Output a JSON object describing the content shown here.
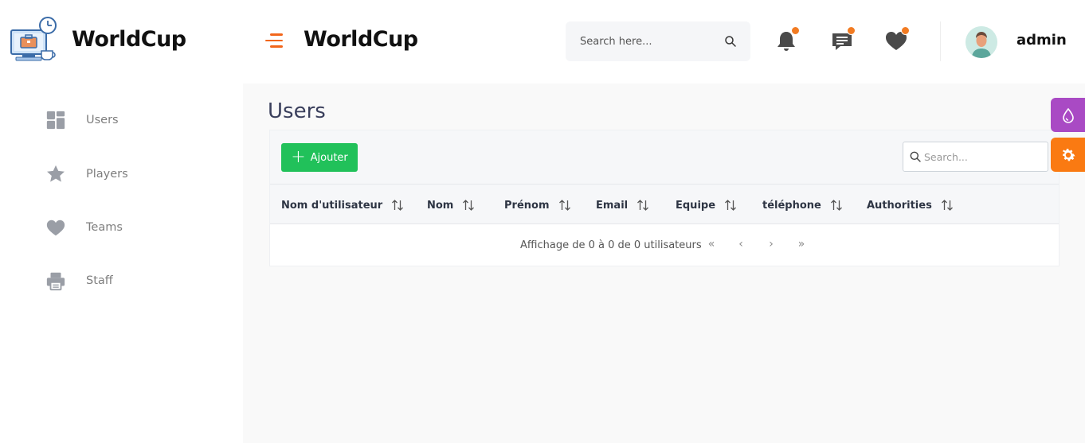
{
  "brand": {
    "name": "WorldCup"
  },
  "header": {
    "title": "WorldCup",
    "search_placeholder": "Search here...",
    "username": "admin",
    "icons": [
      "bell-icon",
      "message-icon",
      "heart-icon"
    ],
    "accent_color": "#f27b22"
  },
  "sidebar": {
    "items": [
      {
        "label": "Users",
        "icon": "dashboard-icon"
      },
      {
        "label": "Players",
        "icon": "star-icon"
      },
      {
        "label": "Teams",
        "icon": "heart-icon"
      },
      {
        "label": "Staff",
        "icon": "printer-icon"
      }
    ]
  },
  "main": {
    "page_title": "Users",
    "add_button_label": "Ajouter",
    "table_search_placeholder": "Search...",
    "columns": [
      "Nom d'utilisateur",
      "Nom",
      "Prénom",
      "Email",
      "Equipe",
      "téléphone",
      "Authorities"
    ],
    "pagination_info": "Affichage de 0 à 0 de 0 utilisateurs",
    "pagination_buttons": [
      "«",
      "‹",
      "›",
      "»"
    ]
  },
  "colors": {
    "add_button": "#21c15a",
    "theme_button": "#a94ac4",
    "settings_button": "#fa7a12",
    "menu_accent": "#f2661b"
  }
}
